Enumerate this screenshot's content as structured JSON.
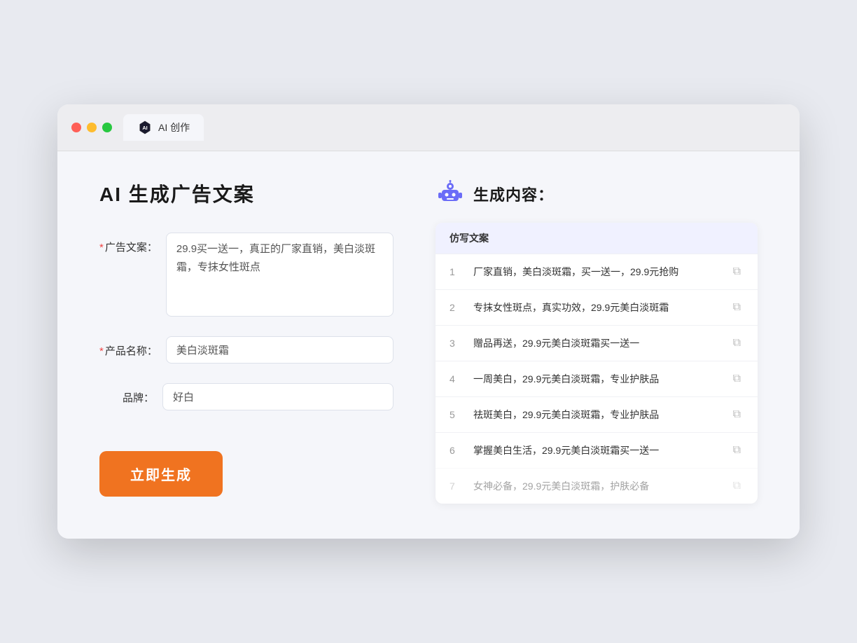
{
  "browser": {
    "tab_label": "AI 创作",
    "controls": {
      "close": "close",
      "minimize": "minimize",
      "maximize": "maximize"
    }
  },
  "left_panel": {
    "page_title": "AI 生成广告文案",
    "form": {
      "ad_copy_label": "广告文案：",
      "ad_copy_required": "*",
      "ad_copy_value": "29.9买一送一，真正的厂家直销，美白淡斑霜，专抹女性斑点",
      "product_name_label": "产品名称：",
      "product_name_required": "*",
      "product_name_value": "美白淡斑霜",
      "brand_label": "品牌：",
      "brand_value": "好白"
    },
    "generate_btn_label": "立即生成"
  },
  "right_panel": {
    "result_title": "生成内容：",
    "table_header": "仿写文案",
    "rows": [
      {
        "num": "1",
        "text": "厂家直销，美白淡斑霜，买一送一，29.9元抢购"
      },
      {
        "num": "2",
        "text": "专抹女性斑点，真实功效，29.9元美白淡斑霜"
      },
      {
        "num": "3",
        "text": "赠品再送，29.9元美白淡斑霜买一送一"
      },
      {
        "num": "4",
        "text": "一周美白，29.9元美白淡斑霜，专业护肤品"
      },
      {
        "num": "5",
        "text": "祛斑美白，29.9元美白淡斑霜，专业护肤品"
      },
      {
        "num": "6",
        "text": "掌握美白生活，29.9元美白淡斑霜买一送一"
      },
      {
        "num": "7",
        "text": "女神必备，29.9元美白淡斑霜，护肤必备"
      }
    ]
  }
}
